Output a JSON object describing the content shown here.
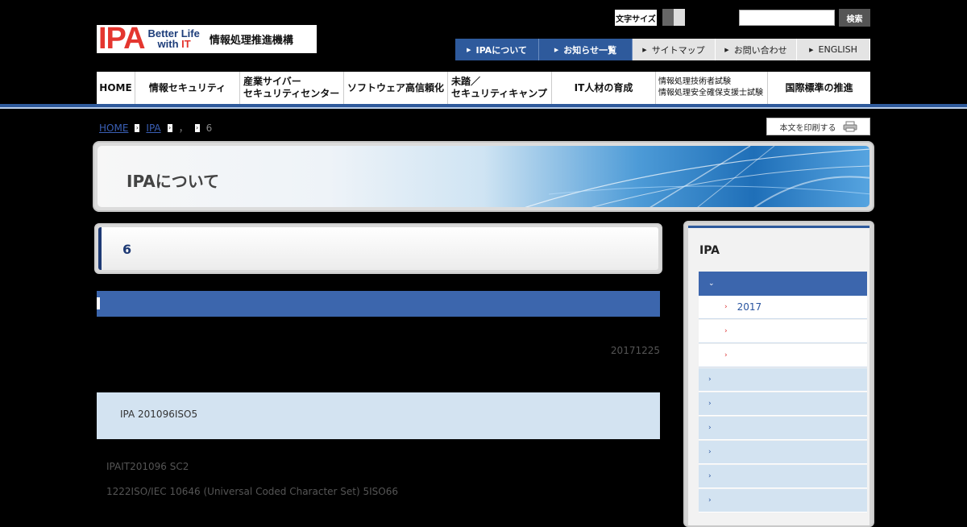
{
  "header": {
    "logo_ipa": "IPA",
    "logo_tagline_1": "Better Life",
    "logo_tagline_2a": "with ",
    "logo_tagline_2b": "IT",
    "org_name": "情報処理推進機構",
    "fontsize_label": "文字サイズ",
    "search_button": "検索",
    "search_placeholder": ""
  },
  "utility_nav": [
    {
      "label": "IPAについて"
    },
    {
      "label": "お知らせ一覧"
    },
    {
      "label": "サイトマップ"
    },
    {
      "label": "お問い合わせ"
    },
    {
      "label": "ENGLISH"
    }
  ],
  "main_nav": [
    {
      "line1": "HOME",
      "line2": ""
    },
    {
      "line1": "情報セキュリティ",
      "line2": ""
    },
    {
      "line1": "産業サイバー",
      "line2": "セキュリティセンター"
    },
    {
      "line1": "ソフトウェア高信頼化",
      "line2": ""
    },
    {
      "line1": "未踏／",
      "line2": "セキュリティキャンプ"
    },
    {
      "line1": "IT人材の育成",
      "line2": ""
    },
    {
      "line1": "情報処理技術者試験",
      "line2": "情報処理安全確保支援士試験"
    },
    {
      "line1": "国際標準の推進",
      "line2": ""
    }
  ],
  "breadcrumb": {
    "home": "HOME",
    "ipa": "IPA",
    "sep_dot": "，",
    "current": "6"
  },
  "print_button": "本文を印刷する",
  "banner_title": "IPAについて",
  "page_heading": "6",
  "date": "20171225",
  "info_text": "IPA 201096ISO5",
  "para1": "IPAIT201096  SC2",
  "para2": "1222ISO/IEC 10646 (Universal Coded Character Set) 5ISO66",
  "sidebar": {
    "title": "IPA",
    "active_chevron": "⌄",
    "sub_items": [
      {
        "label": "2017"
      },
      {
        "label": ""
      },
      {
        "label": ""
      }
    ],
    "top_items": [
      {
        "label": ""
      },
      {
        "label": ""
      },
      {
        "label": ""
      },
      {
        "label": ""
      },
      {
        "label": ""
      },
      {
        "label": ""
      }
    ]
  },
  "colors": {
    "nav_blue": "#2e5a9c",
    "section_blue": "#3c66ad",
    "light_blue": "#d3e3f1",
    "logo_red": "#e4362f"
  }
}
